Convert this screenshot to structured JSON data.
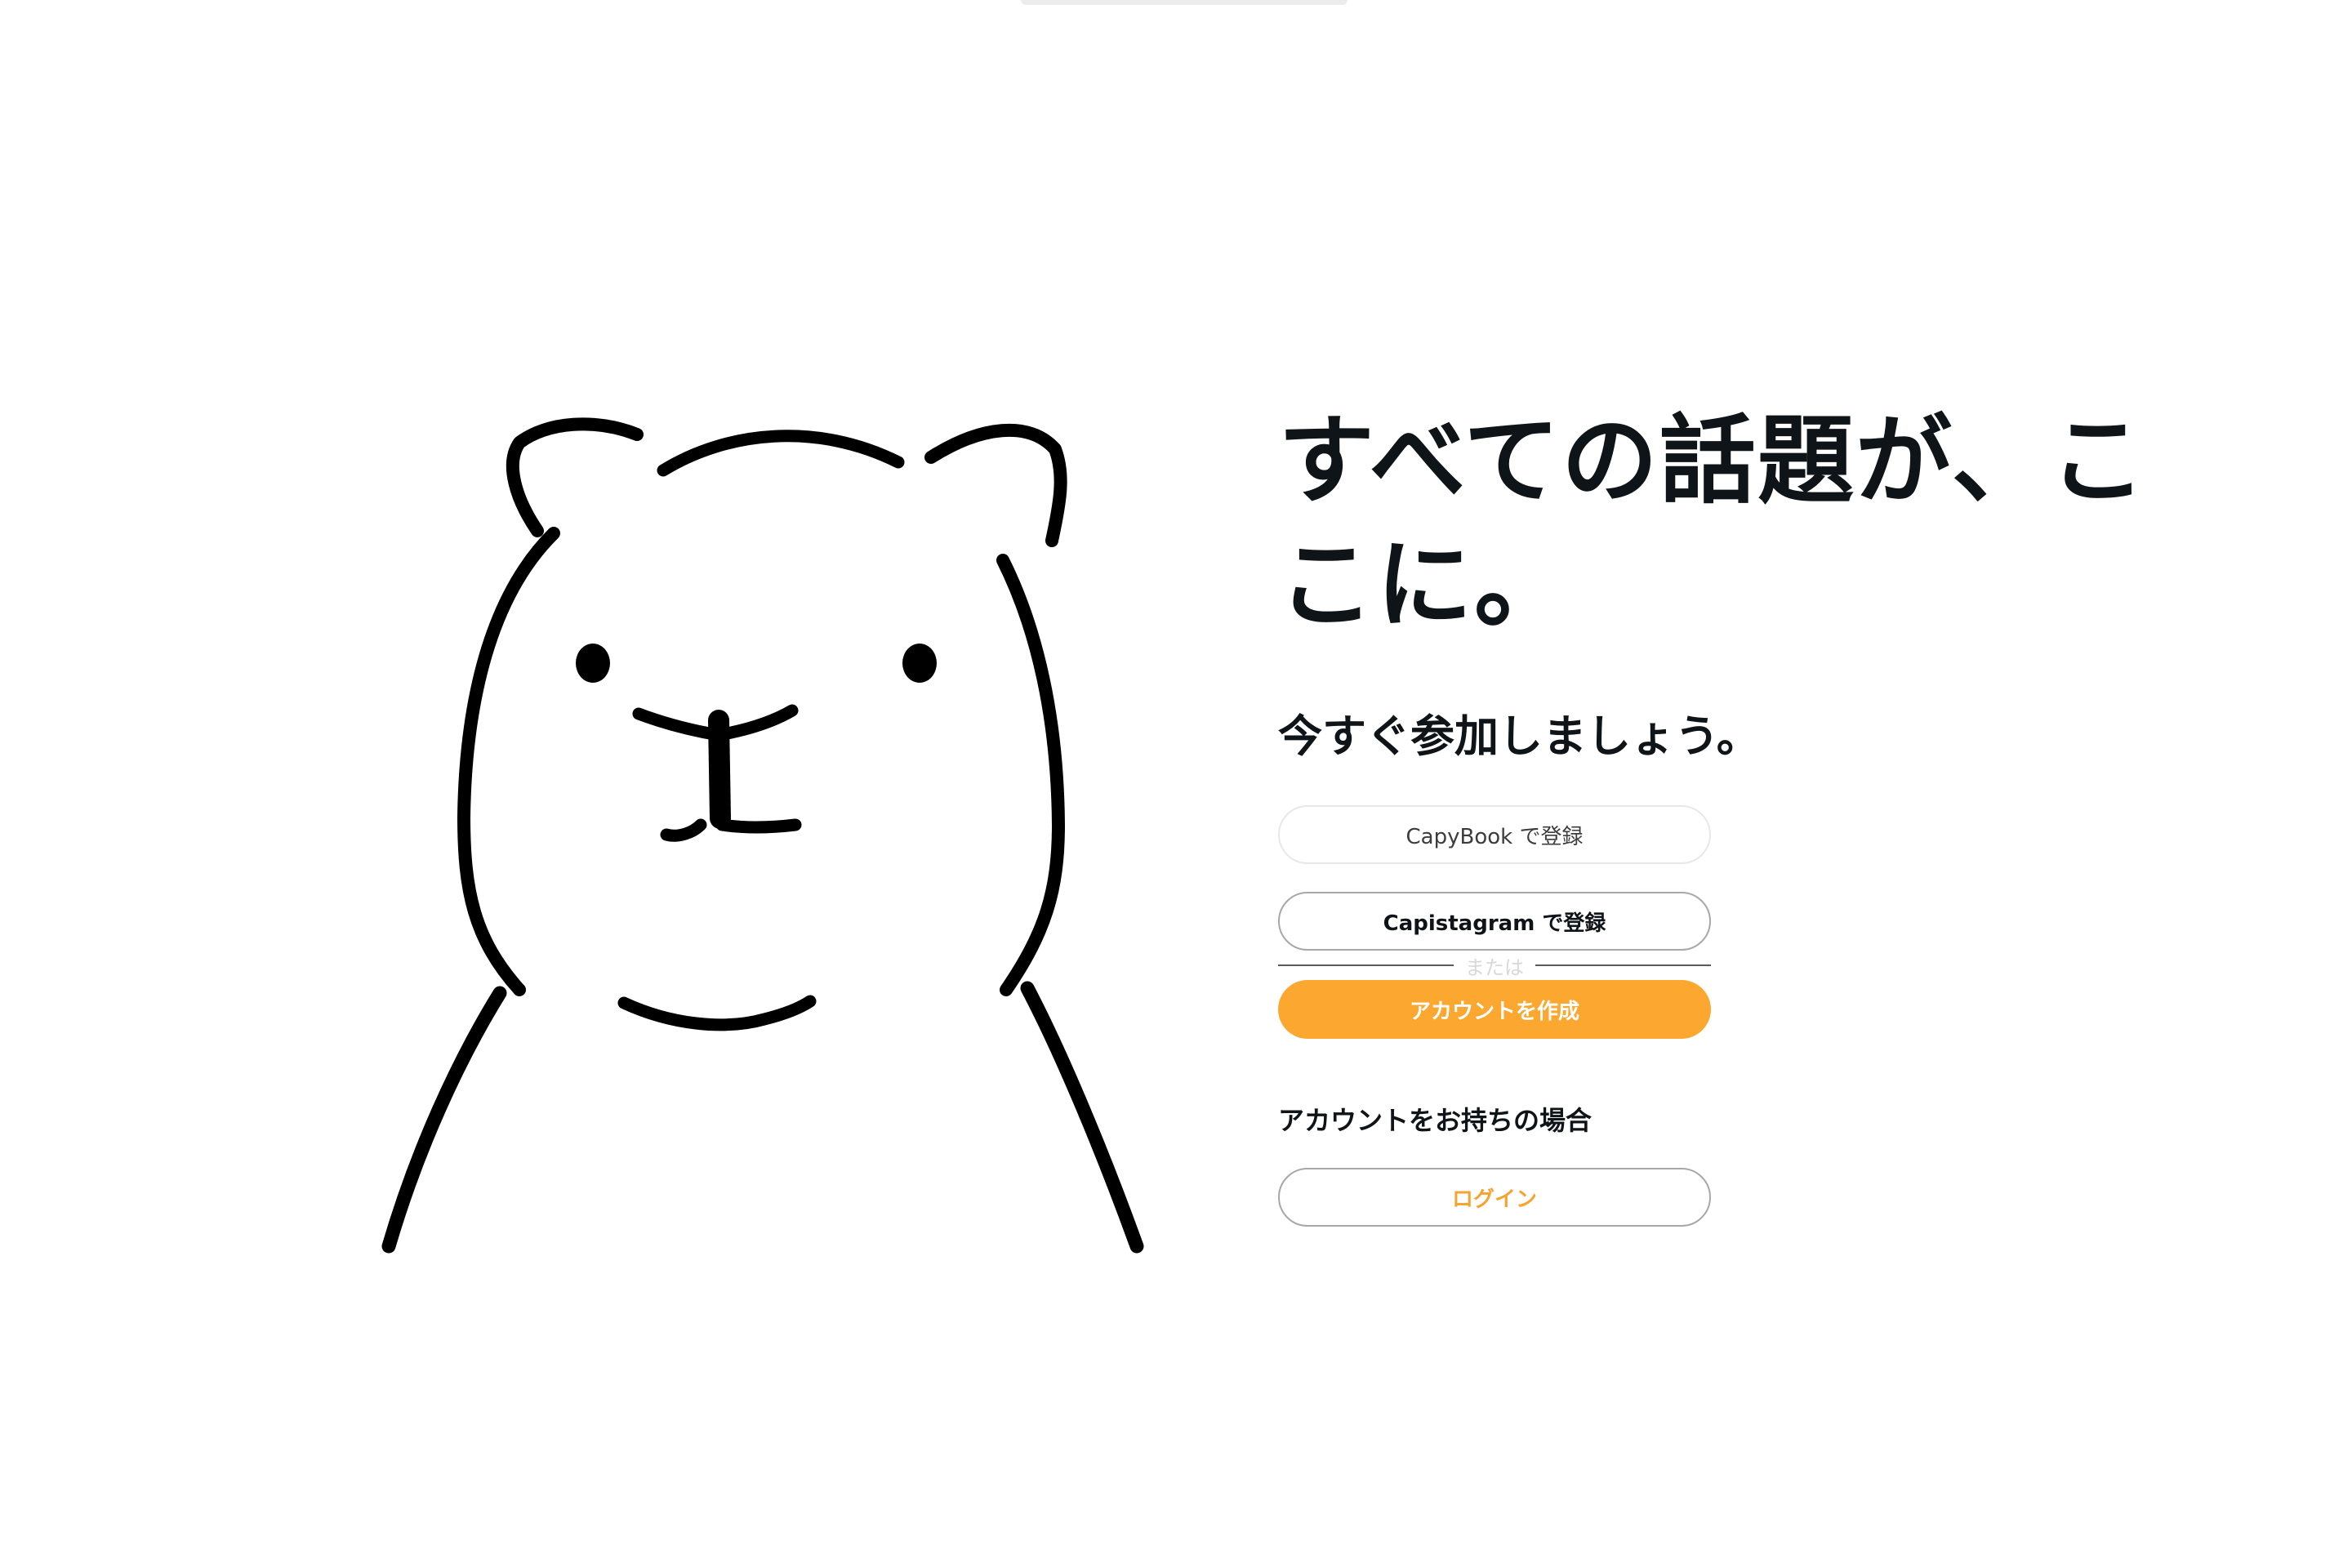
{
  "hero": {
    "headline": "すべての話題が、ここに。",
    "subheadline": "今すぐ参加しましょう。"
  },
  "signup": {
    "capybook_button": "CapyBook で登録",
    "capistagram_button": "Capistagram で登録",
    "divider_text": "または",
    "create_account_button": "アカウントを作成"
  },
  "login": {
    "prompt": "アカウントをお持ちの場合",
    "button": "ログイン"
  },
  "mascot": {
    "icon": "capybara-mascot-icon"
  },
  "colors": {
    "accent": "#fca72f",
    "login_text": "#f5a331",
    "text": "#0f1419"
  }
}
